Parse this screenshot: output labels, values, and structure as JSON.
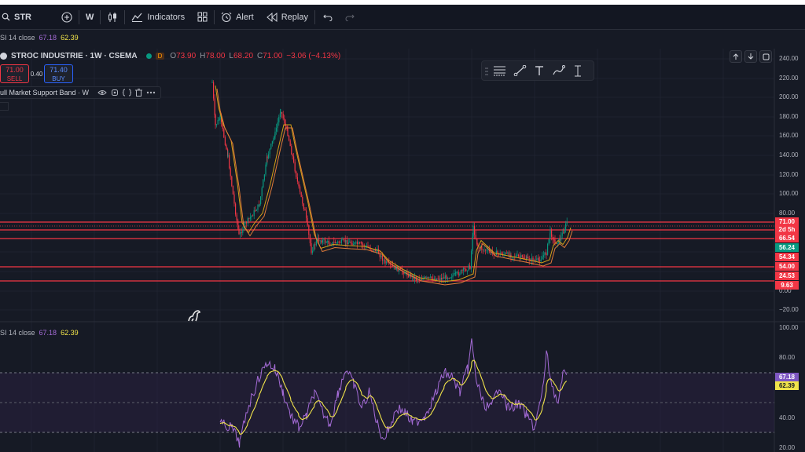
{
  "toolbar": {
    "symbol": "STR",
    "interval": "W",
    "indicators_label": "Indicators",
    "alert_label": "Alert",
    "replay_label": "Replay"
  },
  "rsi_top_legend": {
    "name": "SI 14 close",
    "value1": "67.18",
    "value2": "62.39"
  },
  "main_legend": {
    "title": "STROC INDUSTRIE · 1W · CSEMA",
    "badge": "D",
    "o_label": "O",
    "o_value": "73.90",
    "h_label": "H",
    "h_value": "78.00",
    "l_label": "L",
    "l_value": "68.20",
    "c_label": "C",
    "c_value": "71.00",
    "change": "−3.06 (−4.13%)"
  },
  "trade": {
    "sell_price": "71.00",
    "sell_label": "SELL",
    "spread": "0.40",
    "buy_price": "71.40",
    "buy_label": "BUY"
  },
  "indicator_legend": {
    "name": "ull Market Support Band · W"
  },
  "rsi_legend": {
    "name": "SI 14 close",
    "value1": "67.18",
    "value2": "62.39"
  },
  "price_axis": [
    "240.00",
    "220.00",
    "200.00",
    "180.00",
    "160.00",
    "140.00",
    "120.00",
    "100.00",
    "80.00",
    "0.00",
    "−20.00"
  ],
  "price_badges": [
    {
      "text": "71.00",
      "color": "#f23645"
    },
    {
      "text": "2d 5h",
      "color": "#f23645"
    },
    {
      "text": "66.54",
      "color": "#f23645"
    },
    {
      "text": "56.24",
      "color": "#089981"
    },
    {
      "text": "54.34",
      "color": "#f23645"
    },
    {
      "text": "54.00",
      "color": "#f23645"
    },
    {
      "text": "24.53",
      "color": "#f23645"
    },
    {
      "text": "9.63",
      "color": "#f23645"
    }
  ],
  "rsi_axis": [
    "100.00",
    "80.00",
    "40.00",
    "20.00"
  ],
  "rsi_badges": [
    {
      "text": "67.18",
      "color": "#7e57c2"
    },
    {
      "text": "62.39",
      "color": "#f0e34a"
    }
  ],
  "colors": {
    "up": "#089981",
    "down": "#f23645",
    "rsi": "#a46bd6",
    "rsi_ma": "#f0e34a",
    "line": "#f23645"
  }
}
